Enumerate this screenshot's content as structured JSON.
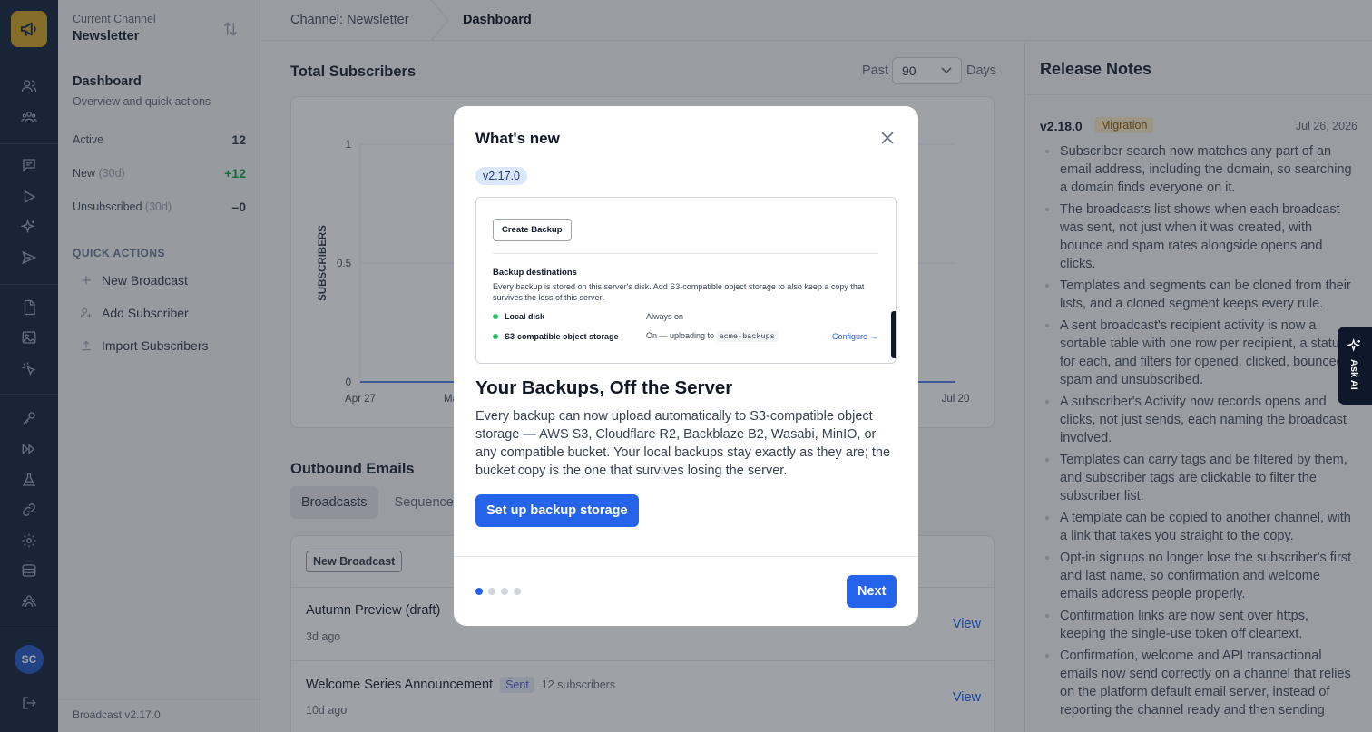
{
  "rail": {
    "logo_icon": "megaphone-icon",
    "icons": [
      "users-icon",
      "groups-icon",
      "message-icon",
      "play-icon",
      "sparkle-icon",
      "send-icon",
      "file-icon",
      "image-icon",
      "cursor-click-icon",
      "key-icon",
      "sequence-icon",
      "flask-icon",
      "link-icon",
      "gear-icon",
      "database-icon",
      "team-icon"
    ],
    "avatar": "SC",
    "logout_icon": "logout-icon"
  },
  "sidebar": {
    "channel_label": "Current Channel",
    "channel_name": "Newsletter",
    "section_title": "Dashboard",
    "section_subtitle": "Overview and quick actions",
    "stats": [
      {
        "label": "Active",
        "meta": "",
        "value": "12"
      },
      {
        "label": "New",
        "meta": "(30d)",
        "value": "+12"
      },
      {
        "label": "Unsubscribed",
        "meta": "(30d)",
        "value": "–0"
      }
    ],
    "quick_actions_title": "QUICK ACTIONS",
    "quick_actions": [
      "New Broadcast",
      "Add Subscriber",
      "Import Subscribers"
    ],
    "version": "Broadcast v2.17.0"
  },
  "breadcrumb": {
    "parent": "Channel: Newsletter",
    "current": "Dashboard"
  },
  "subscribers": {
    "title": "Total Subscribers",
    "past_label": "Past",
    "days_value": "90",
    "days_label": "Days"
  },
  "chart_data": {
    "type": "line",
    "title": "",
    "xlabel": "",
    "ylabel": "SUBSCRIBERS",
    "x_ticks_visible": [
      "Apr 27",
      "Ma",
      "Jul 20"
    ],
    "y_ticks": [
      "0",
      "0.5",
      "1"
    ],
    "ylim": [
      0,
      1
    ],
    "series": [
      {
        "values": [
          0,
          0
        ]
      }
    ],
    "grid": true
  },
  "outbound": {
    "title": "Outbound Emails",
    "tabs": [
      "Broadcasts",
      "Sequence"
    ],
    "new_broadcast": "New Broadcast",
    "rows": [
      {
        "title": "Autumn Preview (draft)",
        "status": "",
        "subscribers": "",
        "date": "3d ago",
        "action": "View"
      },
      {
        "title": "Welcome Series Announcement",
        "status": "Sent",
        "subscribers": "12 subscribers",
        "date": "10d ago",
        "action": "View"
      }
    ]
  },
  "release_notes": {
    "title": "Release Notes",
    "version": "v2.18.0",
    "tag": "Migration",
    "date": "Jul 26, 2026",
    "items": [
      "Subscriber search now matches any part of an email address, including the domain, so searching a domain finds everyone on it.",
      "The broadcasts list shows when each broadcast was sent, not just when it was created, with bounce and spam rates alongside opens and clicks.",
      "Templates and segments can be cloned from their lists, and a cloned segment keeps every rule.",
      "A sent broadcast's recipient activity is now a sortable table with one row per recipient, a status for each, and filters for opened, clicked, bounced, spam and unsubscribed.",
      "A subscriber's Activity now records opens and clicks, not just sends, each naming the broadcast involved.",
      "Templates can carry tags and be filtered by them, and subscriber tags are clickable to filter the subscriber list.",
      "A template can be copied to another channel, with a link that takes you straight to the copy.",
      "Opt-in signups no longer lose the subscriber's first and last name, so confirmation and welcome emails address people properly.",
      "Confirmation links are now sent over https, keeping the single-use token off cleartext.",
      "Confirmation, welcome and API transactional emails now send correctly on a channel that relies on the platform default email server, instead of reporting the channel ready and then sending"
    ]
  },
  "ask_ai": {
    "label": "Ask AI",
    "icon": "sparkle-icon"
  },
  "modal": {
    "title": "What's new",
    "version": "v2.17.0",
    "preview": {
      "create_backup": "Create Backup",
      "destinations_title": "Backup destinations",
      "destinations_desc": "Every backup is stored on this server's disk. Add S3-compatible object storage to also keep a copy that survives the loss of this server.",
      "local_name": "Local disk",
      "local_value": "Always on",
      "s3_name": "S3-compatible object storage",
      "s3_value_prefix": "On — uploading to",
      "s3_bucket": "acme-backups",
      "configure": "Configure →"
    },
    "heading": "Your Backups, Off the Server",
    "body": "Every backup can now upload automatically to S3-compatible object storage — AWS S3, Cloudflare R2, Backblaze B2, Wasabi, MinIO, or any compatible bucket. Your local backups stay exactly as they are; the bucket copy is the one that survives losing the server.",
    "cta": "Set up backup storage",
    "page_total": 4,
    "page_current": 1,
    "next": "Next"
  },
  "colors": {
    "accent": "#2563eb",
    "rail": "#1b2a43",
    "logo": "#d4a72c",
    "positive": "#16a34a"
  }
}
